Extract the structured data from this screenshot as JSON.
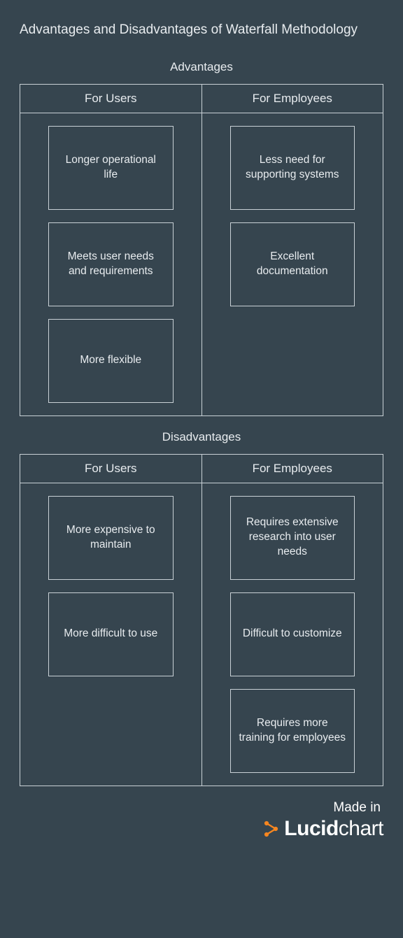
{
  "title": "Advantages and Disadvantages of Waterfall Methodology",
  "sections": [
    {
      "label": "Advantages",
      "columns": [
        {
          "header": "For Users",
          "items": [
            "Longer operational life",
            "Meets user needs and requirements",
            "More flexible"
          ]
        },
        {
          "header": "For Employees",
          "items": [
            "Less need for supporting systems",
            "Excellent documentation"
          ]
        }
      ]
    },
    {
      "label": "Disadvantages",
      "columns": [
        {
          "header": "For Users",
          "items": [
            "More expensive to maintain",
            "More difficult to use"
          ]
        },
        {
          "header": "For Employees",
          "items": [
            "Requires extensive research into user needs",
            "Difficult to customize",
            "Requires more training for employees"
          ]
        }
      ]
    }
  ],
  "attribution": {
    "madein": "Made in",
    "brand_a": "Lucid",
    "brand_b": "chart",
    "accent": "#f68620"
  }
}
